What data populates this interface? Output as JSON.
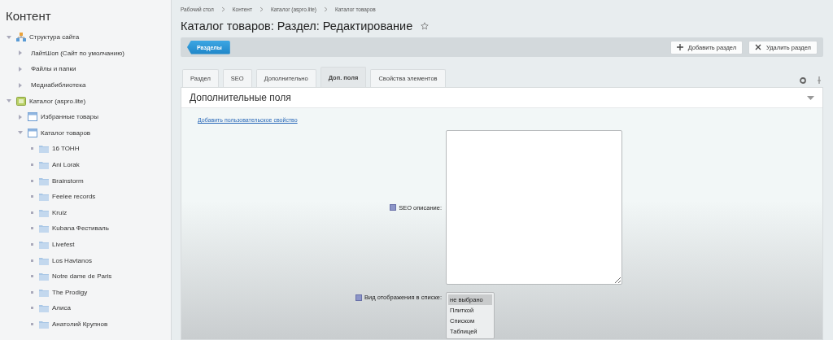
{
  "sidebar": {
    "title": "Контент",
    "tree": [
      {
        "label": "Структура сайта",
        "kind": "structure",
        "expanded": true,
        "children": [
          {
            "label": "ЛайтШоп (Сайт по умолчанию)",
            "kind": "plain",
            "expanded": false
          },
          {
            "label": "Файлы и папки",
            "kind": "plain",
            "expanded": false
          },
          {
            "label": "Медиабиблиотека",
            "kind": "plain",
            "expanded": false
          }
        ]
      },
      {
        "label": "Каталог (aspro.lite)",
        "kind": "catalog",
        "expanded": true,
        "children": [
          {
            "label": "Избранные товары",
            "kind": "iblock",
            "expanded": false
          },
          {
            "label": "Каталог товаров",
            "kind": "iblock",
            "expanded": true,
            "children": [
              {
                "label": "16 ТОНН",
                "kind": "folder"
              },
              {
                "label": "Ani Lorak",
                "kind": "folder"
              },
              {
                "label": "Brainstorm",
                "kind": "folder"
              },
              {
                "label": "Feelee records",
                "kind": "folder"
              },
              {
                "label": "Kruiz",
                "kind": "folder"
              },
              {
                "label": "Kubana Фестиваль",
                "kind": "folder"
              },
              {
                "label": "Livefest",
                "kind": "folder"
              },
              {
                "label": "Los Havtanos",
                "kind": "folder"
              },
              {
                "label": "Notre dame de Paris",
                "kind": "folder"
              },
              {
                "label": "The Prodigy",
                "kind": "folder"
              },
              {
                "label": "Алиса",
                "kind": "folder"
              },
              {
                "label": "Анатолий Крупнов",
                "kind": "folder"
              }
            ]
          }
        ]
      }
    ]
  },
  "breadcrumbs": [
    "Рабочий стол",
    "Контент",
    "Каталог (aspro.lite)",
    "Каталог товаров"
  ],
  "title": "Каталог товаров: Раздел: Редактирование",
  "toolbar": {
    "back_button": "Разделы",
    "buttons": [
      {
        "label": "Добавить раздел",
        "kind": "add"
      },
      {
        "label": "Удалить раздел",
        "kind": "delete"
      }
    ]
  },
  "tabs": [
    {
      "label": "Раздел",
      "selected": false
    },
    {
      "label": "SEO",
      "selected": false
    },
    {
      "label": "Дополнительно",
      "selected": false
    },
    {
      "label": "Доп. поля",
      "selected": true
    },
    {
      "label": "Свойства элементов",
      "selected": false
    }
  ],
  "panel": {
    "title": "Дополнительные поля",
    "add_link": "Добавить пользовательское свойство",
    "fields": [
      {
        "label": "SEO описание:",
        "kind": "textarea"
      },
      {
        "label": "Вид отображения в списке:",
        "kind": "listbox",
        "options": [
          {
            "label": "не выбрано",
            "selected": true
          },
          {
            "label": "Плиткой",
            "selected": false
          },
          {
            "label": "Списком",
            "selected": false
          },
          {
            "label": "Таблицей",
            "selected": false
          }
        ]
      }
    ]
  }
}
